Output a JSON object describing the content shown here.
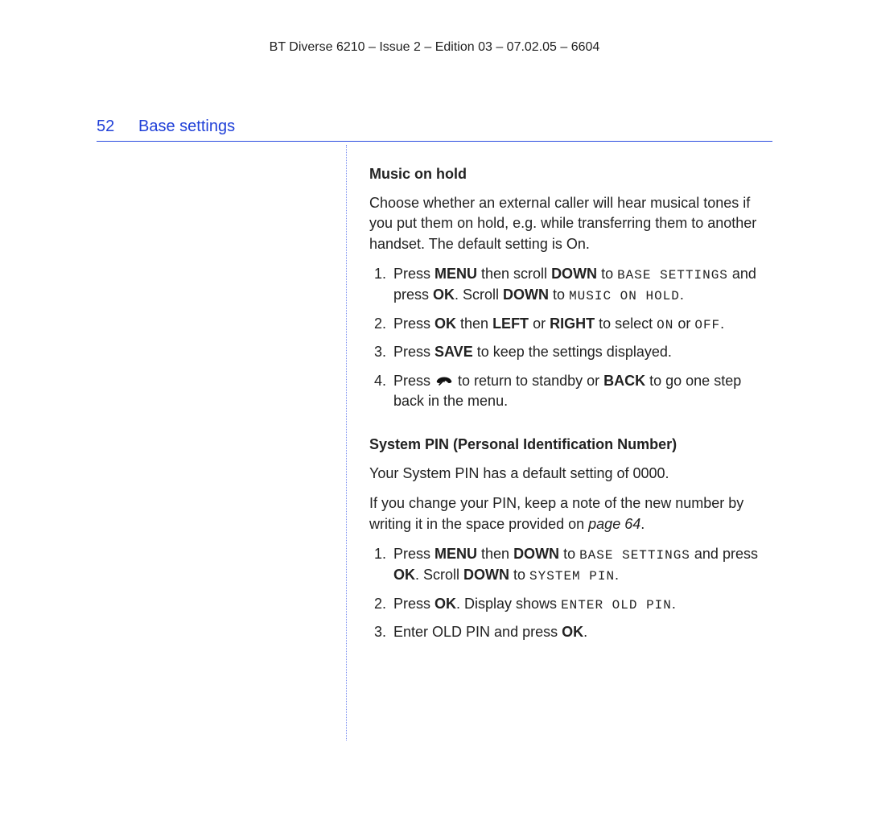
{
  "doc_header": "BT Diverse 6210 – Issue 2 – Edition 03 – 07.02.05 – 6604",
  "page_number": "52",
  "section_title": "Base settings",
  "music": {
    "heading": "Music on hold",
    "intro": "Choose whether an external caller will hear musical tones if you put them on hold, e.g. while transferring them to another handset. The default setting is On.",
    "step1": {
      "t1": "Press ",
      "menu": "MENU",
      "t2": " then scroll ",
      "down1": "DOWN",
      "t3": " to ",
      "lcd1": "BASE SETTINGS",
      "t4": " and press ",
      "ok": "OK",
      "t5": ". Scroll ",
      "down2": "DOWN",
      "t6": " to ",
      "lcd2": "MUSIC ON HOLD",
      "t7": "."
    },
    "step2": {
      "t1": "Press ",
      "ok": "OK",
      "t2": " then ",
      "left": "LEFT",
      "t3": " or ",
      "right": "RIGHT",
      "t4": " to select ",
      "on": "ON",
      "t5": " or ",
      "off": "OFF",
      "t6": "."
    },
    "step3": {
      "t1": "Press ",
      "save": "SAVE",
      "t2": " to keep the settings displayed."
    },
    "step4": {
      "t1": "Press ",
      "icon": "end-call-icon",
      "t2": " to return to standby or ",
      "back": "BACK",
      "t3": " to go one step back in the menu."
    }
  },
  "pin": {
    "heading": "System PIN (Personal Identification Number)",
    "p1": "Your System PIN has a default setting of 0000.",
    "p2a": "If you change your PIN, keep a note of the new number by writing it in the space provided on ",
    "p2_page": "page 64",
    "p2b": ".",
    "step1": {
      "t1": "Press ",
      "menu": "MENU",
      "t2": " then ",
      "down1": "DOWN",
      "t3": " to ",
      "lcd1": "BASE SETTINGS",
      "t4": " and press ",
      "ok": "OK",
      "t5": ". Scroll ",
      "down2": "DOWN",
      "t6": " to ",
      "lcd2": "SYSTEM PIN",
      "t7": "."
    },
    "step2": {
      "t1": "Press ",
      "ok": "OK",
      "t2": ". Display shows ",
      "lcd": "ENTER OLD PIN",
      "t3": "."
    },
    "step3": {
      "t1": "Enter OLD PIN and press ",
      "ok": "OK",
      "t2": "."
    }
  }
}
